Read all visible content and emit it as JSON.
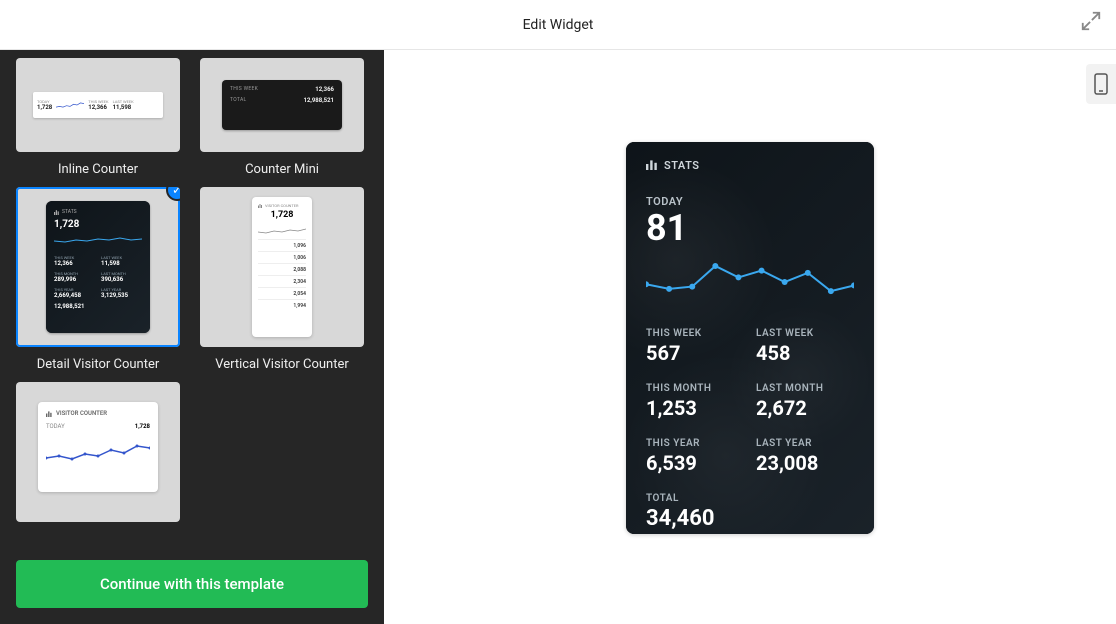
{
  "header": {
    "title": "Edit Widget"
  },
  "sidebar": {
    "templates": [
      {
        "id": "inline",
        "label": "Inline Counter"
      },
      {
        "id": "mini",
        "label": "Counter Mini"
      },
      {
        "id": "detail",
        "label": "Detail Visitor Counter",
        "selected": true
      },
      {
        "id": "vertical",
        "label": "Vertical Visitor Counter"
      },
      {
        "id": "card",
        "label": ""
      }
    ],
    "continue_label": "Continue with this template"
  },
  "thumbs": {
    "inline": {
      "today_label": "TODAY",
      "today": "1,728",
      "thisweek_label": "THIS WEEK",
      "thisweek": "12,366",
      "lastweek_label": "LAST WEEK",
      "lastweek": "11,598"
    },
    "mini": {
      "thisweek_label": "THIS WEEK",
      "thisweek": "12,366",
      "total_label": "TOTAL",
      "total": "12,988,521"
    },
    "detail": {
      "stats": "STATS",
      "today": "1,728",
      "rows": [
        {
          "l": "THIS WEEK",
          "v": "12,366"
        },
        {
          "l": "LAST WEEK",
          "v": "11,598"
        },
        {
          "l": "THIS MONTH",
          "v": "289,996"
        },
        {
          "l": "LAST MONTH",
          "v": "390,636"
        },
        {
          "l": "THIS YEAR",
          "v": "2,669,458"
        },
        {
          "l": "LAST YEAR",
          "v": "3,129,535"
        }
      ],
      "total": "12,988,521"
    },
    "vertical": {
      "hdr": "VISITOR COUNTER",
      "today": "1,728",
      "items": [
        "1,096",
        "1,006",
        "2,088",
        "2,304",
        "2,054",
        "1,994"
      ]
    },
    "card": {
      "hdr": "VISITOR COUNTER",
      "today_label": "TODAY",
      "today": "1,728"
    }
  },
  "widget": {
    "title": "STATS",
    "today_label": "TODAY",
    "today_value": "81",
    "cells": [
      {
        "label": "THIS WEEK",
        "value": "567"
      },
      {
        "label": "LAST WEEK",
        "value": "458"
      },
      {
        "label": "THIS MONTH",
        "value": "1,253"
      },
      {
        "label": "LAST MONTH",
        "value": "2,672"
      },
      {
        "label": "THIS YEAR",
        "value": "6,539"
      },
      {
        "label": "LAST YEAR",
        "value": "23,008"
      }
    ],
    "total_label": "TOTAL",
    "total_value": "34,460"
  },
  "chart_data": {
    "type": "line",
    "title": "Today visitor sparkline",
    "x": [
      1,
      2,
      3,
      4,
      5,
      6,
      7,
      8,
      9,
      10
    ],
    "values": [
      72,
      68,
      70,
      88,
      78,
      84,
      74,
      82,
      66,
      71
    ],
    "ylim": [
      60,
      95
    ],
    "color": "#3aa8ef"
  }
}
